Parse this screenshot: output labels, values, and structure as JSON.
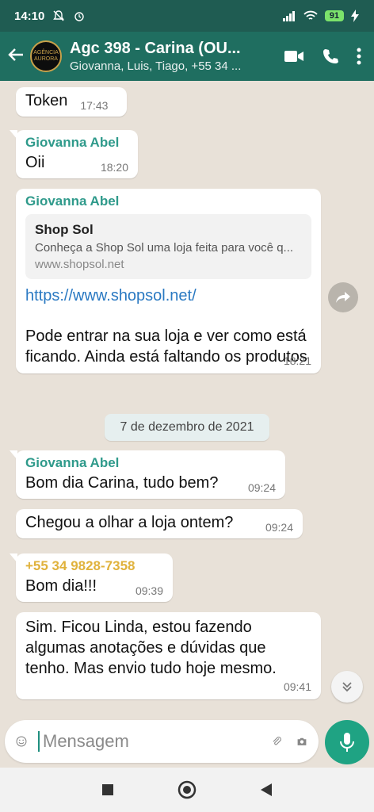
{
  "status_bar": {
    "time": "14:10",
    "battery": "91"
  },
  "header": {
    "title": "Agc 398 - Carina (OU...",
    "subtitle": "Giovanna, Luis, Tiago, +55 34 ...",
    "avatar_text": "AGÊNCIA AURORA"
  },
  "messages": [
    {
      "text": "Token",
      "time": "17:43"
    },
    {
      "sender": "Giovanna Abel",
      "text": "Oii",
      "time": "18:20"
    },
    {
      "sender": "Giovanna Abel",
      "preview": {
        "title": "Shop Sol",
        "description": "Conheça a Shop Sol uma loja feita para você q...",
        "url": "www.shopsol.net"
      },
      "link": "https://www.shopsol.net/",
      "text": "Pode entrar na sua loja e ver como está ficando. Ainda está faltando os produtos",
      "time": "18:21"
    },
    {
      "sender": "Giovanna Abel",
      "text": "Bom dia Carina, tudo bem?",
      "time": "09:24"
    },
    {
      "text": "Chegou a olhar a loja ontem?",
      "time": "09:24"
    },
    {
      "sender": "+55 34 9828-7358",
      "text": "Bom dia!!!",
      "time": "09:39"
    },
    {
      "text": "Sim. Ficou Linda, estou fazendo algumas anotações e dúvidas que tenho. Mas envio tudo hoje mesmo.",
      "time": "09:41"
    }
  ],
  "date_divider": "7 de dezembro de 2021",
  "input": {
    "placeholder": "Mensagem"
  },
  "colors": {
    "header": "#1f6e60",
    "accent": "#1fa383",
    "sender": "#2f9a8b",
    "phone_sender": "#e0b23c",
    "link": "#2a79c2"
  }
}
